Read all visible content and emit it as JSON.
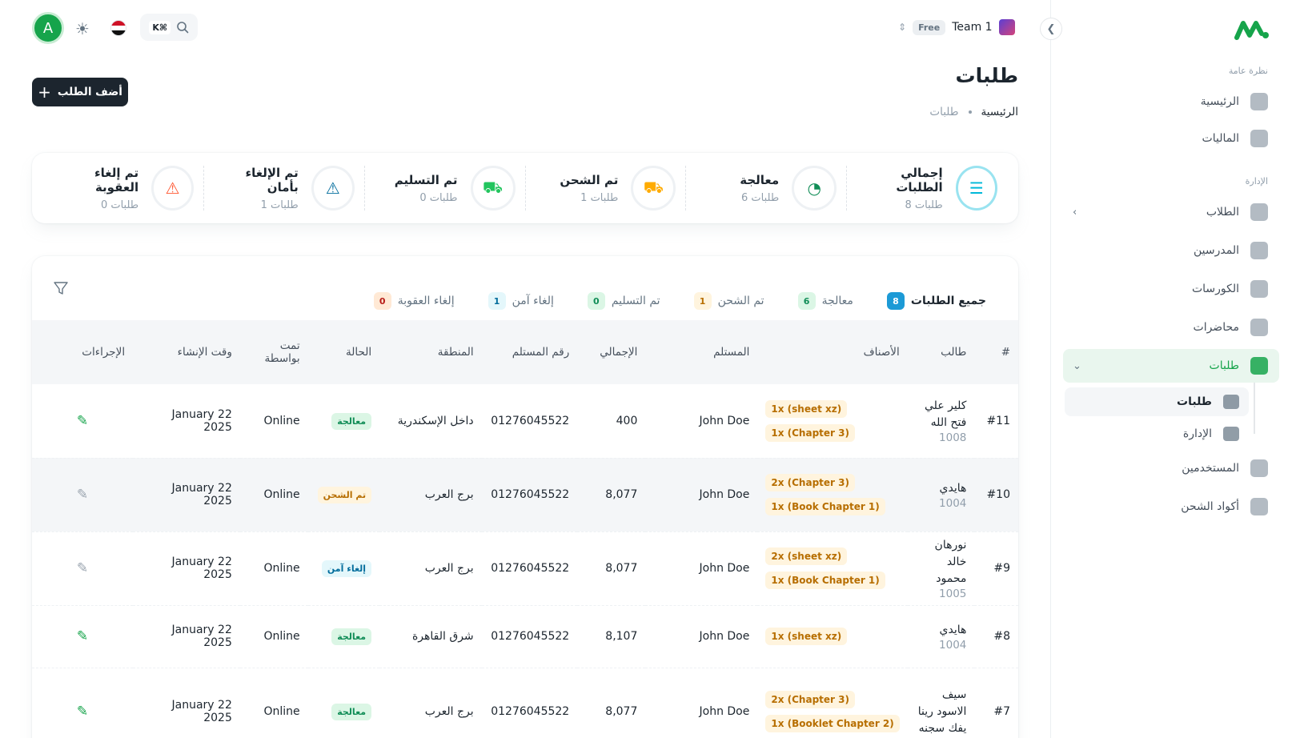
{
  "sidebar": {
    "section_overview": "نظرة عامة",
    "section_admin": "الإدارة",
    "items": [
      {
        "label": "الرئيسية"
      },
      {
        "label": "الماليات"
      },
      {
        "label": "الطلاب"
      },
      {
        "label": "المدرسين"
      },
      {
        "label": "الكورسات"
      },
      {
        "label": "محاضرات"
      },
      {
        "label": "طلبات"
      },
      {
        "label": "المستخدمين"
      },
      {
        "label": "أكواد الشحن"
      }
    ],
    "sub_items": [
      {
        "label": "طلبات"
      },
      {
        "label": "الإدارة"
      }
    ]
  },
  "header": {
    "avatar_letter": "A",
    "shortcut": "K⌘",
    "plan": "Free",
    "team": "Team 1"
  },
  "page": {
    "title": "طلبات",
    "breadcrumb_home": "الرئيسية",
    "breadcrumb_current": "طلبات",
    "add_button": "أضف الطلب"
  },
  "stats": [
    {
      "label": "إجمالي الطلبات",
      "count": "8 طلبات",
      "color": "#00b8d9"
    },
    {
      "label": "معالجة",
      "count": "6 طلبات",
      "color": "#118d57"
    },
    {
      "label": "تم الشحن",
      "count": "1 طلبات",
      "color": "#ffab00"
    },
    {
      "label": "تم التسليم",
      "count": "0 طلبات",
      "color": "#22c55e"
    },
    {
      "label": "تم الإلغاء بأمان",
      "count": "1 طلبات",
      "color": "#006c9c"
    },
    {
      "label": "تم إلغاء العقوبة",
      "count": "0 طلبات",
      "color": "#ff5630"
    }
  ],
  "tabs": [
    {
      "label": "جميع الطلبات",
      "count": "8",
      "bg": "#1c9ad6",
      "fg": "#ffffff"
    },
    {
      "label": "معالجة",
      "count": "6",
      "bg": "#dbf6e5",
      "fg": "#118d57"
    },
    {
      "label": "تم الشحن",
      "count": "1",
      "bg": "#fff4de",
      "fg": "#b76e00"
    },
    {
      "label": "تم التسليم",
      "count": "0",
      "bg": "#dbf6e5",
      "fg": "#118d57"
    },
    {
      "label": "إلغاء آمن",
      "count": "1",
      "bg": "#e4f7fb",
      "fg": "#006c9c"
    },
    {
      "label": "إلغاء العقوبة",
      "count": "0",
      "bg": "#ffe9d5",
      "fg": "#b71d18"
    }
  ],
  "table": {
    "headers": [
      "#",
      "طالب",
      "الأصناف",
      "المستلم",
      "الإجمالي",
      "رقم المستلم",
      "المنطقة",
      "الحالة",
      "تمت بواسطة",
      "وقت الإنشاء",
      "الإجراءات"
    ],
    "rows": [
      {
        "num": "#11",
        "name": "كلير علي فتح الله",
        "id": "1008",
        "items": [
          "1x (sheet xz)",
          "1x (Chapter 3)"
        ],
        "recipient": "John Doe",
        "total": "400",
        "phone": "01276045522",
        "region": "داخل الإسكندرية",
        "status": "معالجة",
        "status_kind": "proc",
        "by": "Online",
        "created": "22 January 2025"
      },
      {
        "num": "#10",
        "name": "هايدي",
        "id": "1004",
        "items": [
          "2x (Chapter 3)",
          "1x (Book Chapter 1)"
        ],
        "recipient": "John Doe",
        "total": "8,077",
        "phone": "01276045522",
        "region": "برج العرب",
        "status": "تم الشحن",
        "status_kind": "ship",
        "by": "Online",
        "created": "22 January 2025"
      },
      {
        "num": "#9",
        "name": "نورهان خالد محمود",
        "id": "1005",
        "items": [
          "2x (sheet xz)",
          "1x (Book Chapter 1)"
        ],
        "recipient": "John Doe",
        "total": "8,077",
        "phone": "01276045522",
        "region": "برج العرب",
        "status": "إلغاء آمن",
        "status_kind": "safe",
        "by": "Online",
        "created": "22 January 2025"
      },
      {
        "num": "#8",
        "name": "هايدي",
        "id": "1004",
        "items": [
          "1x (sheet xz)"
        ],
        "recipient": "John Doe",
        "total": "8,107",
        "phone": "01276045522",
        "region": "شرق القاهرة",
        "status": "معالجة",
        "status_kind": "proc",
        "by": "Online",
        "created": "22 January 2025"
      },
      {
        "num": "#7",
        "name": "سيف الاسود رينا يفك سجنه",
        "id": "",
        "items": [
          "2x (Chapter 3)",
          "1x (Booklet Chapter 2)"
        ],
        "recipient": "John Doe",
        "total": "8,077",
        "phone": "01276045522",
        "region": "برج العرب",
        "status": "معالجة",
        "status_kind": "proc",
        "by": "Online",
        "created": "22 January 2025"
      }
    ]
  }
}
